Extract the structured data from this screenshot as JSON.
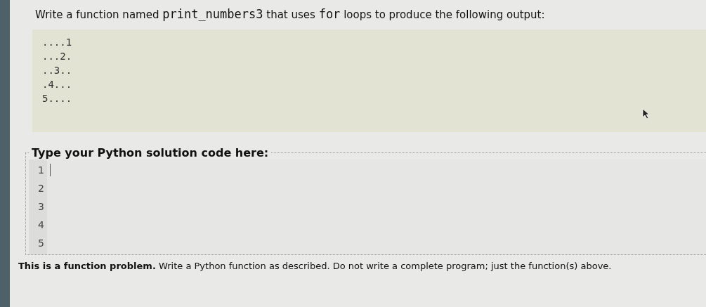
{
  "prompt": [
    {
      "kind": "text",
      "text": "Write a function named "
    },
    {
      "kind": "code",
      "text": "print_numbers3"
    },
    {
      "kind": "text",
      "text": " that uses "
    },
    {
      "kind": "code",
      "text": "for"
    },
    {
      "kind": "text",
      "text": " loops to produce the following output:"
    }
  ],
  "output_lines": [
    "....1",
    "...2.",
    "..3..",
    ".4...",
    "5...."
  ],
  "editor": {
    "label": "Type your Python solution code here:",
    "line_numbers": [
      "1",
      "2",
      "3",
      "4",
      "5"
    ]
  },
  "note": "**This is a function problem.** Write a Python function as described. Do not write a complete program; just the function(s) above."
}
